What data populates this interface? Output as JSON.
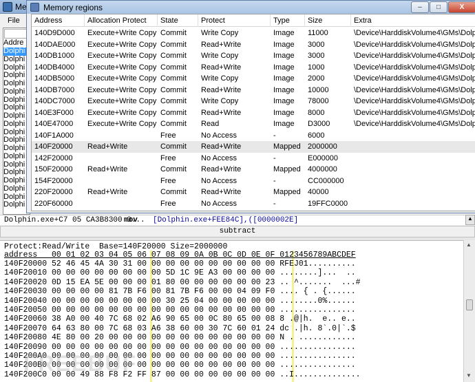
{
  "main": {
    "title": "Me",
    "menu_file": "File",
    "list_header": "Addre",
    "list_items": [
      "Dolphi",
      "Dolphi",
      "Dolphi",
      "Dolphi",
      "Dolphi",
      "Dolphi",
      "Dolphi",
      "Dolphi",
      "Dolphi",
      "Dolphi",
      "Dolphi",
      "Dolphi",
      "Dolphi",
      "Dolphi",
      "Dolphi",
      "Dolphi",
      "Dolphi",
      "Dolphi",
      "Dolphi",
      "Dolphi"
    ]
  },
  "dialog": {
    "title": "Memory regions",
    "btn_minimize": "–",
    "btn_maximize": "□",
    "btn_close": "X",
    "columns": [
      "Address",
      "Allocation Protect",
      "State",
      "Protect",
      "Type",
      "Size",
      "Extra"
    ],
    "rows": [
      [
        "140D9D000",
        "Execute+Write Copy",
        "Commit",
        "Write Copy",
        "Image",
        "11000",
        "\\Device\\HarddiskVolume4\\GMs\\Dolphi"
      ],
      [
        "140DAE000",
        "Execute+Write Copy",
        "Commit",
        "Read+Write",
        "Image",
        "3000",
        "\\Device\\HarddiskVolume4\\GMs\\Dolphi"
      ],
      [
        "140DB1000",
        "Execute+Write Copy",
        "Commit",
        "Write Copy",
        "Image",
        "3000",
        "\\Device\\HarddiskVolume4\\GMs\\Dolphi"
      ],
      [
        "140DB4000",
        "Execute+Write Copy",
        "Commit",
        "Read+Write",
        "Image",
        "1000",
        "\\Device\\HarddiskVolume4\\GMs\\Dolphi"
      ],
      [
        "140DB5000",
        "Execute+Write Copy",
        "Commit",
        "Write Copy",
        "Image",
        "2000",
        "\\Device\\HarddiskVolume4\\GMs\\Dolphi"
      ],
      [
        "140DB7000",
        "Execute+Write Copy",
        "Commit",
        "Read+Write",
        "Image",
        "10000",
        "\\Device\\HarddiskVolume4\\GMs\\Dolphi"
      ],
      [
        "140DC7000",
        "Execute+Write Copy",
        "Commit",
        "Write Copy",
        "Image",
        "78000",
        "\\Device\\HarddiskVolume4\\GMs\\Dolphi"
      ],
      [
        "140E3F000",
        "Execute+Write Copy",
        "Commit",
        "Read+Write",
        "Image",
        "8000",
        "\\Device\\HarddiskVolume4\\GMs\\Dolphi"
      ],
      [
        "140E47000",
        "Execute+Write Copy",
        "Commit",
        "Read",
        "Image",
        "D3000",
        "\\Device\\HarddiskVolume4\\GMs\\Dolphi"
      ],
      [
        "140F1A000",
        "",
        "Free",
        "No Access",
        "-",
        "6000",
        ""
      ],
      [
        "140F20000",
        "Read+Write",
        "Commit",
        "Read+Write",
        "Mapped",
        "2000000",
        ""
      ],
      [
        "142F20000",
        "",
        "Free",
        "No Access",
        "-",
        "E000000",
        ""
      ],
      [
        "150F20000",
        "Read+Write",
        "Commit",
        "Read+Write",
        "Mapped",
        "4000000",
        ""
      ],
      [
        "154F20000",
        "",
        "Free",
        "No Access",
        "-",
        "CC000000",
        ""
      ],
      [
        "220F20000",
        "Read+Write",
        "Commit",
        "Read+Write",
        "Mapped",
        "40000",
        ""
      ],
      [
        "220F60000",
        "",
        "Free",
        "No Access",
        "-",
        "19FFC0000",
        ""
      ]
    ]
  },
  "disasm": {
    "addr": "Dolphin.exe+C7 05 CA3B8300 0...",
    "mnemonic": "mov",
    "operand": "[Dolphin.exe+FEE84C],([0000002E]"
  },
  "status": "subtract",
  "hex": {
    "info": "Protect:Read/Write  Base=140F20000 Size=2000000",
    "header": "address   00 01 02 03 04 05 06 07 08 09 0A 0B 0C 0D 0E 0F 0123456789ABCDEF",
    "lines": [
      "140F20000 52 46 45 4A 30 31 00 00 00 00 00 00 00 00 00 00 RFEJ01..........",
      "140F20010 00 00 00 00 00 00 00 00 5D 1C 9E A3 00 00 00 00 ........]...  ..",
      "140F20020 0D 15 EA 5E 00 00 00 01 80 00 00 00 00 00 00 23 .. ^.......  ...#",
      "140F20030 00 00 00 00 81 7B F6 00 81 7B F6 00 00 04 09 F0 .... { . {......",
      "140F20040 00 00 00 00 00 00 00 00 30 25 04 00 00 00 00 00 ........0%......",
      "140F20050 00 00 00 00 00 00 00 00 00 00 00 00 00 00 00 00 ................",
      "140F20060 38 A0 00 40 7C 68 02 A6 90 65 00 0C 80 65 00 08 8 .@|h.  e.. e..",
      "140F20070 64 63 80 00 7C 68 03 A6 38 60 00 30 7C 60 01 24 dc .|h. 8`.0|`.$",
      "140F20080 4E 80 00 20 00 00 00 00 00 00 00 00 00 00 00 00 N . ............",
      "140F20090 00 00 00 00 00 00 00 00 00 00 00 00 00 00 00 00 ................",
      "140F200A0 00 00 00 00 00 00 00 00 00 00 00 00 00 00 00 00 ................",
      "140F200B0 00 00 00 00 00 00 00 00 00 00 00 00 00 00 00 00 ................",
      "140F200C0 00 00 49 88 F8 F2 FF 87 00 00 00 00 00 00 00 00 ..I.............."
    ]
  },
  "watermark": "FREEBUF"
}
